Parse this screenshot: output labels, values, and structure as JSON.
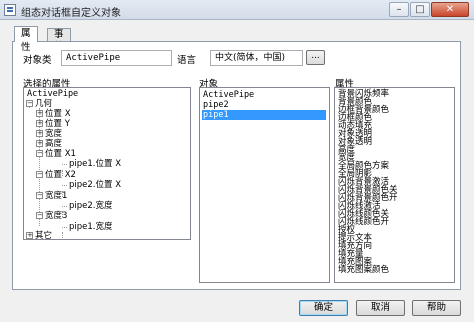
{
  "window": {
    "title": "组态对话框自定义对象",
    "minimize": "–",
    "maximize": "□",
    "close": "✕"
  },
  "tabs": [
    {
      "label": "属性"
    },
    {
      "label": "事件"
    }
  ],
  "object_class": {
    "label": "对象类",
    "value": "ActivePipe"
  },
  "language": {
    "label": "语言",
    "value": "中文(简体，中国)",
    "browse_label": "..."
  },
  "selected_properties": {
    "header": "选择的属性",
    "items": [
      {
        "text": "ActivePipe",
        "toggle": ""
      },
      {
        "text": "几何",
        "toggle": "−"
      },
      {
        "text": "位置 X",
        "toggle": "+"
      },
      {
        "text": "位置 Y",
        "toggle": "+"
      },
      {
        "text": "宽度",
        "toggle": "+"
      },
      {
        "text": "高度",
        "toggle": "+"
      },
      {
        "text": "位置 X1",
        "toggle": "−"
      },
      {
        "text": "pipe1.位置 X",
        "toggle": ""
      },
      {
        "text": "位置 X2",
        "toggle": "−"
      },
      {
        "text": "pipe2.位置 X",
        "toggle": ""
      },
      {
        "text": "宽度1",
        "toggle": "−"
      },
      {
        "text": "pipe2.宽度",
        "toggle": ""
      },
      {
        "text": "宽度3",
        "toggle": "−"
      },
      {
        "text": "pipe1.宽度",
        "toggle": ""
      },
      {
        "text": "其它",
        "toggle": "+"
      }
    ]
  },
  "objects": {
    "header": "对象",
    "items": [
      "ActivePipe",
      "pipe2",
      "pipe1"
    ],
    "selected": "pipe1"
  },
  "properties": {
    "header": "属性",
    "items": [
      "背景闪烁频率",
      "背景颜色",
      "边框背景颜色",
      "边框颜色",
      "动态填充",
      "对象透明",
      "对象透明",
      "高度",
      "宽度",
      "全局颜色方案",
      "全局阴影",
      "闪烁背景激活",
      "闪烁背景颜色关",
      "闪烁背景颜色开",
      "闪烁线激活",
      "闪烁线颜色关",
      "闪烁线颜色开",
      "授权",
      "提示文本",
      "填充方向",
      "填充量",
      "填充图案",
      "填充图案颜色"
    ]
  },
  "buttons": {
    "ok": "确定",
    "cancel": "取消",
    "help": "帮助"
  },
  "colors": {
    "selection": "#3399ff",
    "default_button_border": "#3c7fb1"
  }
}
